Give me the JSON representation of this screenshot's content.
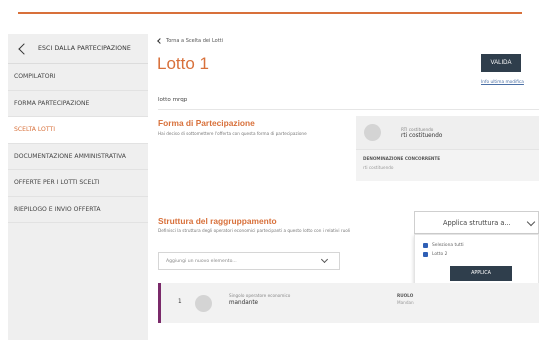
{
  "sidebar": {
    "exit_label": "ESCI DALLA PARTECIPAZIONE",
    "items": [
      {
        "label": "COMPILATORI"
      },
      {
        "label": "FORMA PARTECIPAZIONE"
      },
      {
        "label": "SCELTA LOTTI",
        "active": true
      },
      {
        "label": "DOCUMENTAZIONE AMMINISTRATIVA"
      },
      {
        "label": "OFFERTE PER I LOTTI SCELTI"
      },
      {
        "label": "RIEPILOGO E INVIO OFFERTA"
      }
    ]
  },
  "header": {
    "back_label": "Torna a Scelta dei Lotti",
    "title": "Lotto 1",
    "valida_label": "VALIDA",
    "info_link": "Info ultima modifica",
    "subtitle": "lotto mrqp"
  },
  "forma": {
    "title": "Forma di Partecipazione",
    "desc": "Hai deciso di sottomettere l'offerta con questa forma di partecipazione",
    "card": {
      "small": "RTI costituendo",
      "strong": "rti costituendo",
      "field_label": "DENOMINAZIONE CONCORRENTE",
      "field_value": "rti costituendo"
    }
  },
  "struttura": {
    "title": "Struttura del raggruppamento",
    "desc": "Definisci la struttura degli operatori economici partecipanti a questo lotto con i relativi ruoli",
    "add_placeholder": "Aggiungi un nuovo elemento...",
    "apply_label": "Applica struttura a...",
    "dropdown": {
      "options": [
        "Seleziona tutti",
        "Lotto 2"
      ],
      "button": "APPLICA"
    },
    "member": {
      "num": "1",
      "type": "Singolo operatore economico",
      "role": "mandante",
      "ruolo_label": "RUOLO",
      "ruolo_value": "Mandan"
    }
  },
  "colors": {
    "accent": "#d8703a",
    "dark_button": "#2f3e4c",
    "member_bar": "#7a2a6a",
    "checkbox": "#2f5fb5"
  }
}
